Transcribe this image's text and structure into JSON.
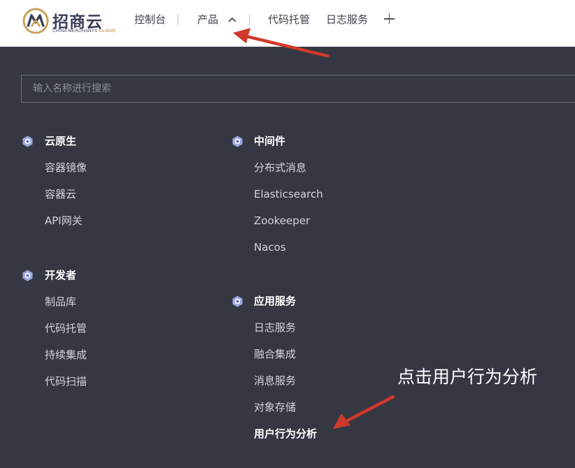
{
  "logo": {
    "title": "招商云",
    "subtitle_main": "CHINA MERCHANTS ",
    "subtitle_accent": "CLOUD"
  },
  "nav": {
    "console": "控制台",
    "products": "产品",
    "code_hosting": "代码托管",
    "log_service": "日志服务"
  },
  "search": {
    "placeholder": "输入名称进行搜索",
    "value": ""
  },
  "categories": [
    {
      "title": "云原生",
      "items": [
        "容器镜像",
        "容器云",
        "API网关"
      ]
    },
    {
      "title": "开发者",
      "items": [
        "制品库",
        "代码托管",
        "持续集成",
        "代码扫描"
      ]
    },
    {
      "title": "中间件",
      "items": [
        "分布式消息",
        "Elasticsearch",
        "Zookeeper",
        "Nacos"
      ]
    },
    {
      "title": "应用服务",
      "items": [
        "日志服务",
        "融合集成",
        "消息服务",
        "对象存储",
        "用户行为分析"
      ]
    }
  ],
  "annotation": {
    "text": "点击用户行为分析"
  },
  "colors": {
    "panel_background": "#353842",
    "annotation_arrow": "#d0392b",
    "logo_gold": "#c9a15b",
    "logo_navy": "#3a3f58"
  },
  "icons": {
    "category": "hexagon-cluster-icon",
    "products_chevron": "chevron-up-icon",
    "add": "plus-icon"
  }
}
